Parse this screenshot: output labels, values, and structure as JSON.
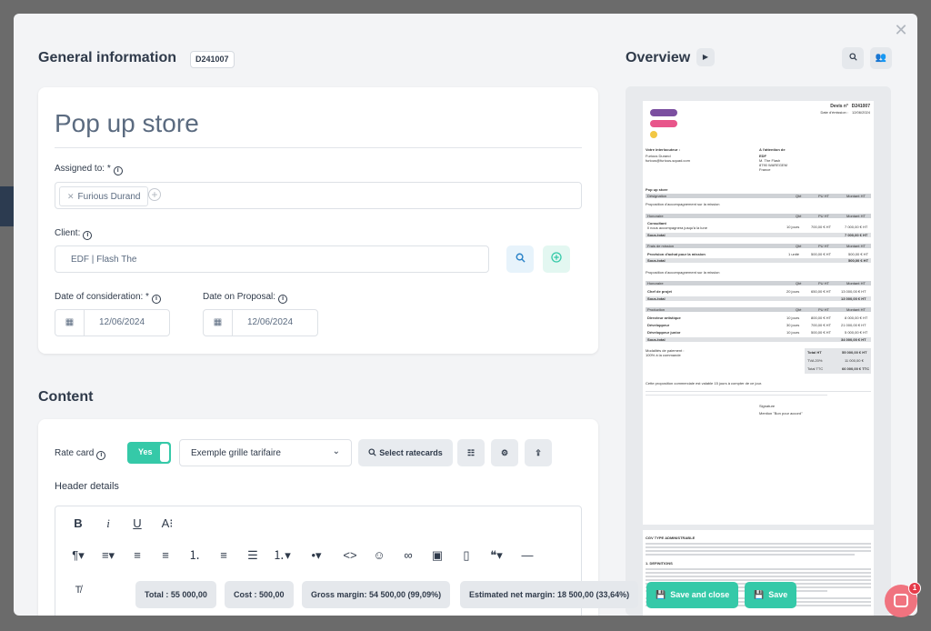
{
  "general": {
    "heading": "General information",
    "badge": "D241007",
    "project_title": "Pop up store",
    "assigned_label": "Assigned to: *",
    "assignee": "Furious Durand",
    "client_label": "Client:",
    "client_value": "EDF | Flash The",
    "consideration_label": "Date of consideration: *",
    "consideration_date": "12/06/2024",
    "proposal_label": "Date on Proposal:",
    "proposal_date": "12/06/2024"
  },
  "content": {
    "heading": "Content",
    "rate_card_label": "Rate card",
    "toggle_label": "Yes",
    "ratecard_selected": "Exemple grille tarifaire",
    "select_ratecards_label": "Select ratecards",
    "header_details_label": "Header details"
  },
  "footer": {
    "total": "Total : 55 000,00",
    "cost": "Cost : 500,00",
    "gross_margin": "Gross margin: 54 500,00 (99,09%)",
    "net_margin": "Estimated net margin: 18 500,00 (33,64%)",
    "save_close_label": "Save and close",
    "save_label": "Save"
  },
  "overview": {
    "heading": "Overview"
  },
  "document": {
    "devis_label": "Devis n°",
    "devis_number": "D241007",
    "emission_label": "Date d'émission :",
    "emission_date": "12/06/2024",
    "contact_heading": "Votre interlocuteur :",
    "contact_name": "Furious Durand",
    "contact_email": "furious@furious-squad.com",
    "attention_heading": "A l'attention de",
    "client_name": "EDF",
    "client_contact": "M. The Flash",
    "client_city": "8790 WAREGEM",
    "client_country": "France",
    "project": "Pop up store",
    "col_designation": "Désignation",
    "col_qte": "Qté",
    "col_pu": "PU HT",
    "col_montant": "Montant HT",
    "proposition": "Proposition d'accompagnement sur la mission",
    "section_honoraire": "Honoraire",
    "consultant": "Consultant",
    "consultant_desc": "Il nous accompagnera jusqu'à la lune",
    "consultant_qty": "10 jours",
    "consultant_pu": "700,00 € HT",
    "consultant_total": "7 000,00 € HT",
    "subtotal_label": "Sous-total",
    "subtotal_1": "7 000,00 € HT",
    "section_frais": "Frais de mission",
    "provision": "Provision d'achat pour la mission",
    "provision_qty": "1 unité",
    "provision_pu": "500,00 € HT",
    "provision_total": "500,00 € HT",
    "subtotal_2": "500,00 € HT",
    "section_honoraire2": "Honoraire",
    "chef": "Chef de projet",
    "chef_qty": "20 jours",
    "chef_pu": "650,00 € HT",
    "chef_total": "13 000,00 € HT",
    "subtotal_3": "13 000,00 € HT",
    "section_production": "Production",
    "da": "Directeur artistique",
    "da_qty": "10 jours",
    "da_pu": "800,00 € HT",
    "da_total": "8 000,00 € HT",
    "dev": "Développeur",
    "dev_qty": "30 jours",
    "dev_pu": "700,00 € HT",
    "dev_total": "21 000,00 € HT",
    "devjr": "Développeur junior",
    "devjr_qty": "10 jours",
    "devjr_pu": "500,00 € HT",
    "devjr_total": "5 000,00 € HT",
    "subtotal_4": "34 000,00 € HT",
    "payment_label": "Modalités de paiement :",
    "payment_value": "100% à la commande",
    "total_ht_label": "Total HT",
    "total_ht": "55 000,00 € HT",
    "tva_label": "TVA 20%",
    "tva": "11 000,00 €",
    "total_ttc_label": "Total TTC",
    "total_ttc": "66 000,00 € TTC",
    "validity": "Cette proposition commerciale est valable 15 jours à compter de ce jour.",
    "signature": "Signature",
    "mention": "Mention \"Bon pour accord\"",
    "cgv_heading": "CGV TYPE ADMINISTRABLE",
    "definitions": "1. DEFINITIONS"
  },
  "chat": {
    "notification_count": "1"
  },
  "colors": {
    "accent": "#35c9a8",
    "logo_purple": "#7b4fa0",
    "logo_pink": "#e8558a",
    "logo_yellow": "#f2c744",
    "chat": "#f0737f"
  }
}
